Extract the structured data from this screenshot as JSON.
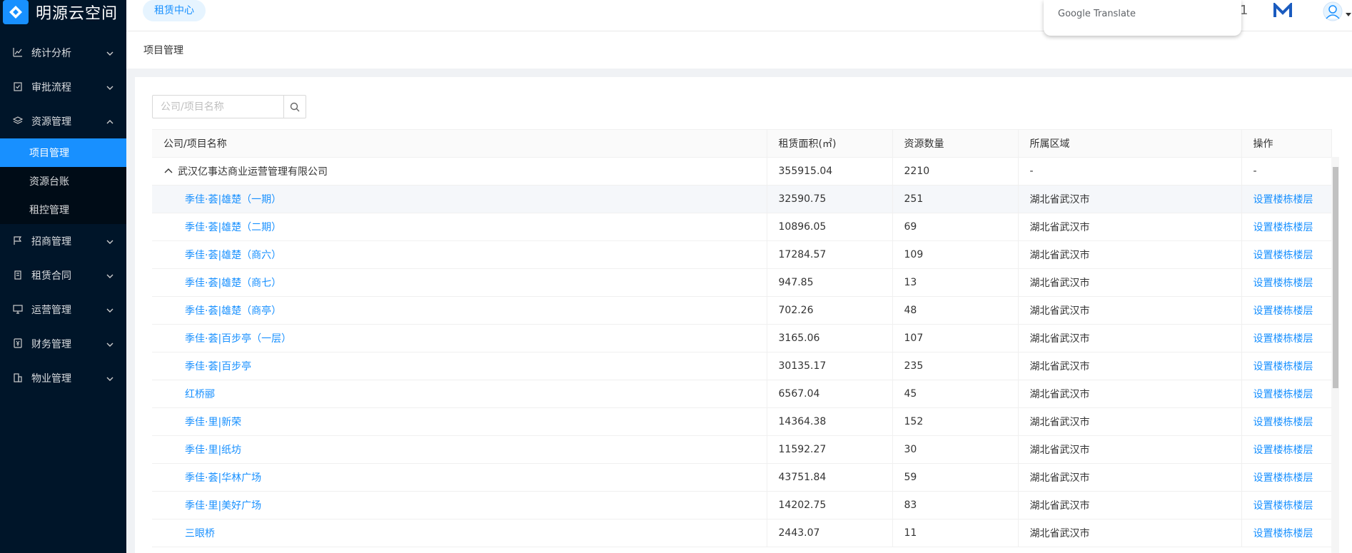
{
  "app": {
    "logo_text": "明源云空间",
    "header_tab": "租赁中心",
    "translate_label": "Google Translate",
    "header_cutoff_char": "1"
  },
  "sidebar": {
    "items": [
      {
        "label": "统计分析",
        "icon": "chart-icon",
        "expanded": false
      },
      {
        "label": "审批流程",
        "icon": "clipboard-check-icon",
        "expanded": false
      },
      {
        "label": "资源管理",
        "icon": "layers-icon",
        "expanded": true,
        "children": [
          {
            "label": "项目管理",
            "active": true
          },
          {
            "label": "资源台账",
            "active": false
          },
          {
            "label": "租控管理",
            "active": false
          }
        ]
      },
      {
        "label": "招商管理",
        "icon": "flag-icon",
        "expanded": false
      },
      {
        "label": "租赁合同",
        "icon": "contract-icon",
        "expanded": false
      },
      {
        "label": "运营管理",
        "icon": "monitor-icon",
        "expanded": false
      },
      {
        "label": "财务管理",
        "icon": "finance-icon",
        "expanded": false
      },
      {
        "label": "物业管理",
        "icon": "building-icon",
        "expanded": false
      }
    ]
  },
  "breadcrumb": "项目管理",
  "search": {
    "placeholder": "公司/项目名称",
    "value": ""
  },
  "table": {
    "columns": [
      "公司/项目名称",
      "租赁面积(㎡)",
      "资源数量",
      "所属区域",
      "操作"
    ],
    "company": {
      "name": "武汉亿事达商业运营管理有限公司",
      "area": "355915.04",
      "count": "2210",
      "region": "-",
      "action": "-"
    },
    "rows": [
      {
        "name": "季佳·荟|雄楚（一期）",
        "area": "32590.75",
        "count": "251",
        "region": "湖北省武汉市",
        "action": "设置楼栋楼层"
      },
      {
        "name": "季佳·荟|雄楚（二期）",
        "area": "10896.05",
        "count": "69",
        "region": "湖北省武汉市",
        "action": "设置楼栋楼层"
      },
      {
        "name": "季佳·荟|雄楚（商六）",
        "area": "17284.57",
        "count": "109",
        "region": "湖北省武汉市",
        "action": "设置楼栋楼层"
      },
      {
        "name": "季佳·荟|雄楚（商七）",
        "area": "947.85",
        "count": "13",
        "region": "湖北省武汉市",
        "action": "设置楼栋楼层"
      },
      {
        "name": "季佳·荟|雄楚（商亭）",
        "area": "702.26",
        "count": "48",
        "region": "湖北省武汉市",
        "action": "设置楼栋楼层"
      },
      {
        "name": "季佳·荟|百步亭（一层）",
        "area": "3165.06",
        "count": "107",
        "region": "湖北省武汉市",
        "action": "设置楼栋楼层"
      },
      {
        "name": "季佳·荟|百步亭",
        "area": "30135.17",
        "count": "235",
        "region": "湖北省武汉市",
        "action": "设置楼栋楼层"
      },
      {
        "name": "红桥郦",
        "area": "6567.04",
        "count": "45",
        "region": "湖北省武汉市",
        "action": "设置楼栋楼层"
      },
      {
        "name": "季佳·里|新荣",
        "area": "14364.38",
        "count": "152",
        "region": "湖北省武汉市",
        "action": "设置楼栋楼层"
      },
      {
        "name": "季佳·里|纸坊",
        "area": "11592.27",
        "count": "30",
        "region": "湖北省武汉市",
        "action": "设置楼栋楼层"
      },
      {
        "name": "季佳·荟|华林广场",
        "area": "43751.84",
        "count": "59",
        "region": "湖北省武汉市",
        "action": "设置楼栋楼层"
      },
      {
        "name": "季佳·里|美好广场",
        "area": "14202.75",
        "count": "83",
        "region": "湖北省武汉市",
        "action": "设置楼栋楼层"
      },
      {
        "name": "三眼桥",
        "area": "2443.07",
        "count": "11",
        "region": "湖北省武汉市",
        "action": "设置楼栋楼层"
      }
    ]
  },
  "colors": {
    "sidebar_bg": "#001529",
    "accent": "#1890ff",
    "link": "#1890ff"
  }
}
